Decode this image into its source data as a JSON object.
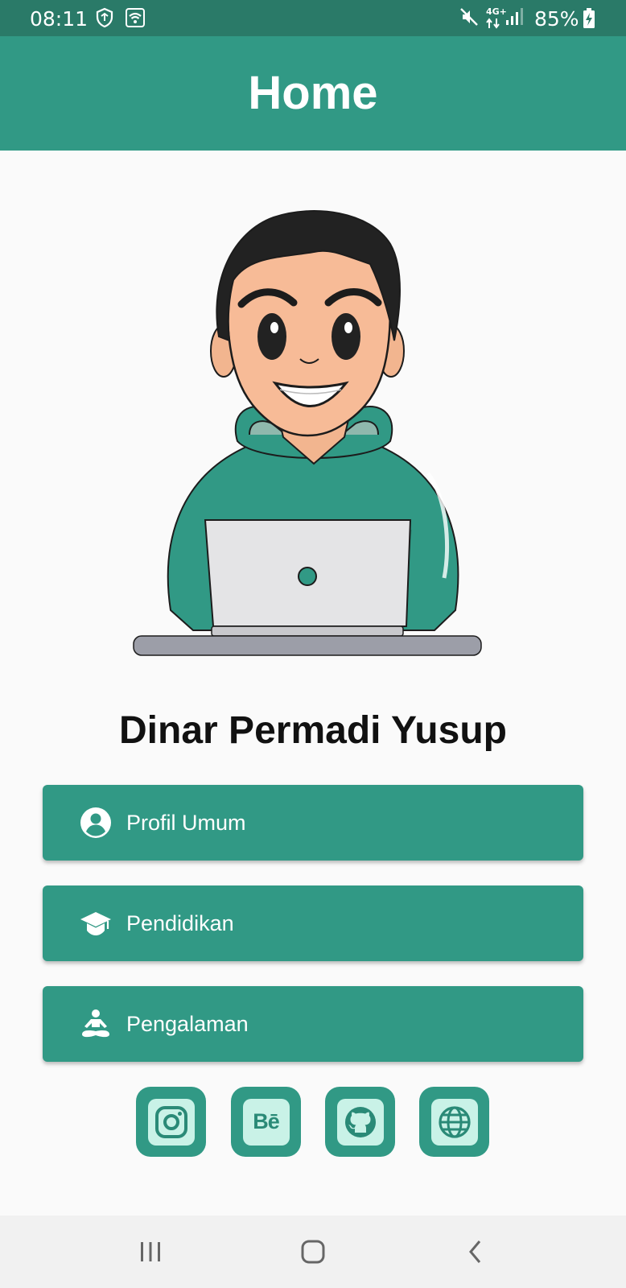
{
  "status_bar": {
    "time": "08:11",
    "network_label": "4G+",
    "battery": "85%"
  },
  "app_bar": {
    "title": "Home"
  },
  "profile": {
    "name": "Dinar Permadi Yusup"
  },
  "menu": [
    {
      "label": "Profil Umum",
      "icon": "account-circle-icon"
    },
    {
      "label": "Pendidikan",
      "icon": "graduation-cap-icon"
    },
    {
      "label": "Pengalaman",
      "icon": "meditation-icon"
    }
  ],
  "social": [
    {
      "name": "instagram-icon",
      "text": ""
    },
    {
      "name": "behance-icon",
      "text": "Bē"
    },
    {
      "name": "github-icon",
      "text": ""
    },
    {
      "name": "globe-icon",
      "text": ""
    }
  ],
  "colors": {
    "primary": "#319985",
    "status_bar": "#2a7a68",
    "icon_tile": "#c9f2e7",
    "background": "#fafafa"
  }
}
